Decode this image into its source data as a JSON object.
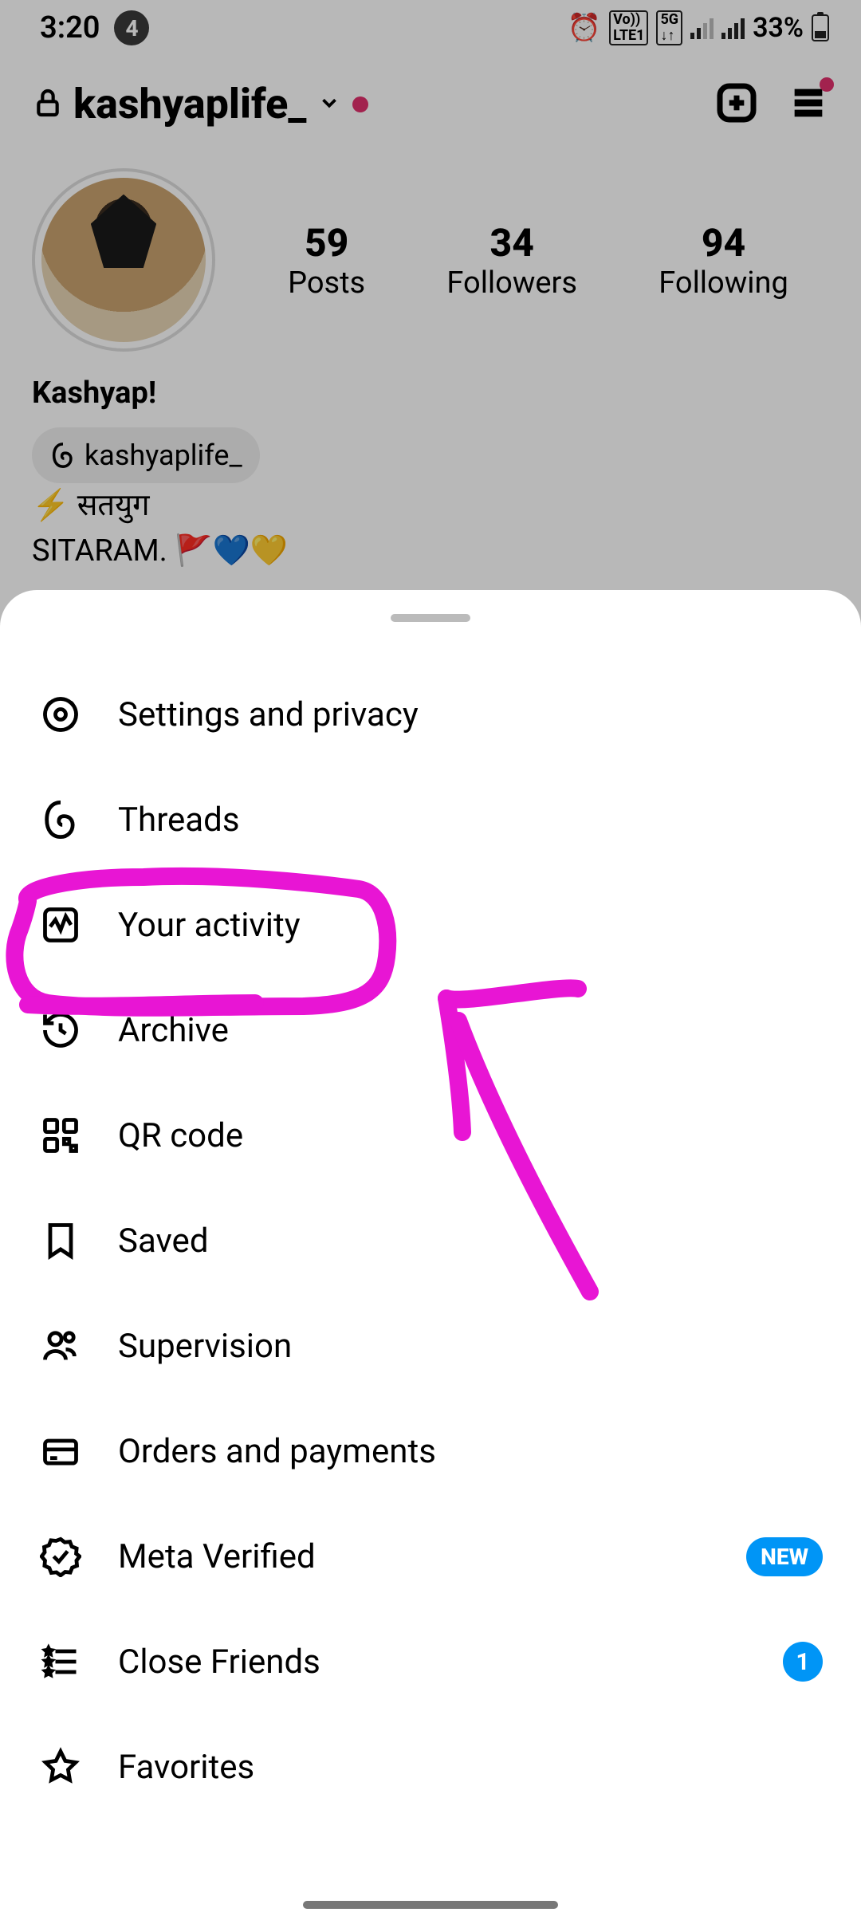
{
  "status": {
    "time": "3:20",
    "notif_count": "4",
    "battery": "33%"
  },
  "header": {
    "username": "kashyaplife_"
  },
  "stats": {
    "posts_num": "59",
    "posts_lbl": "Posts",
    "followers_num": "34",
    "followers_lbl": "Followers",
    "following_num": "94",
    "following_lbl": "Following"
  },
  "bio": {
    "name": "Kashyap!",
    "threads_handle": "kashyaplife_",
    "line1": "⚡ सतयुग",
    "line2": "SITARAM. 🚩💙💛"
  },
  "menu": {
    "settings": "Settings and privacy",
    "threads": "Threads",
    "activity": "Your activity",
    "archive": "Archive",
    "qrcode": "QR code",
    "saved": "Saved",
    "supervision": "Supervision",
    "orders": "Orders and payments",
    "meta_verified": "Meta Verified",
    "meta_badge": "NEW",
    "close_friends": "Close Friends",
    "close_friends_count": "1",
    "favorites": "Favorites"
  }
}
